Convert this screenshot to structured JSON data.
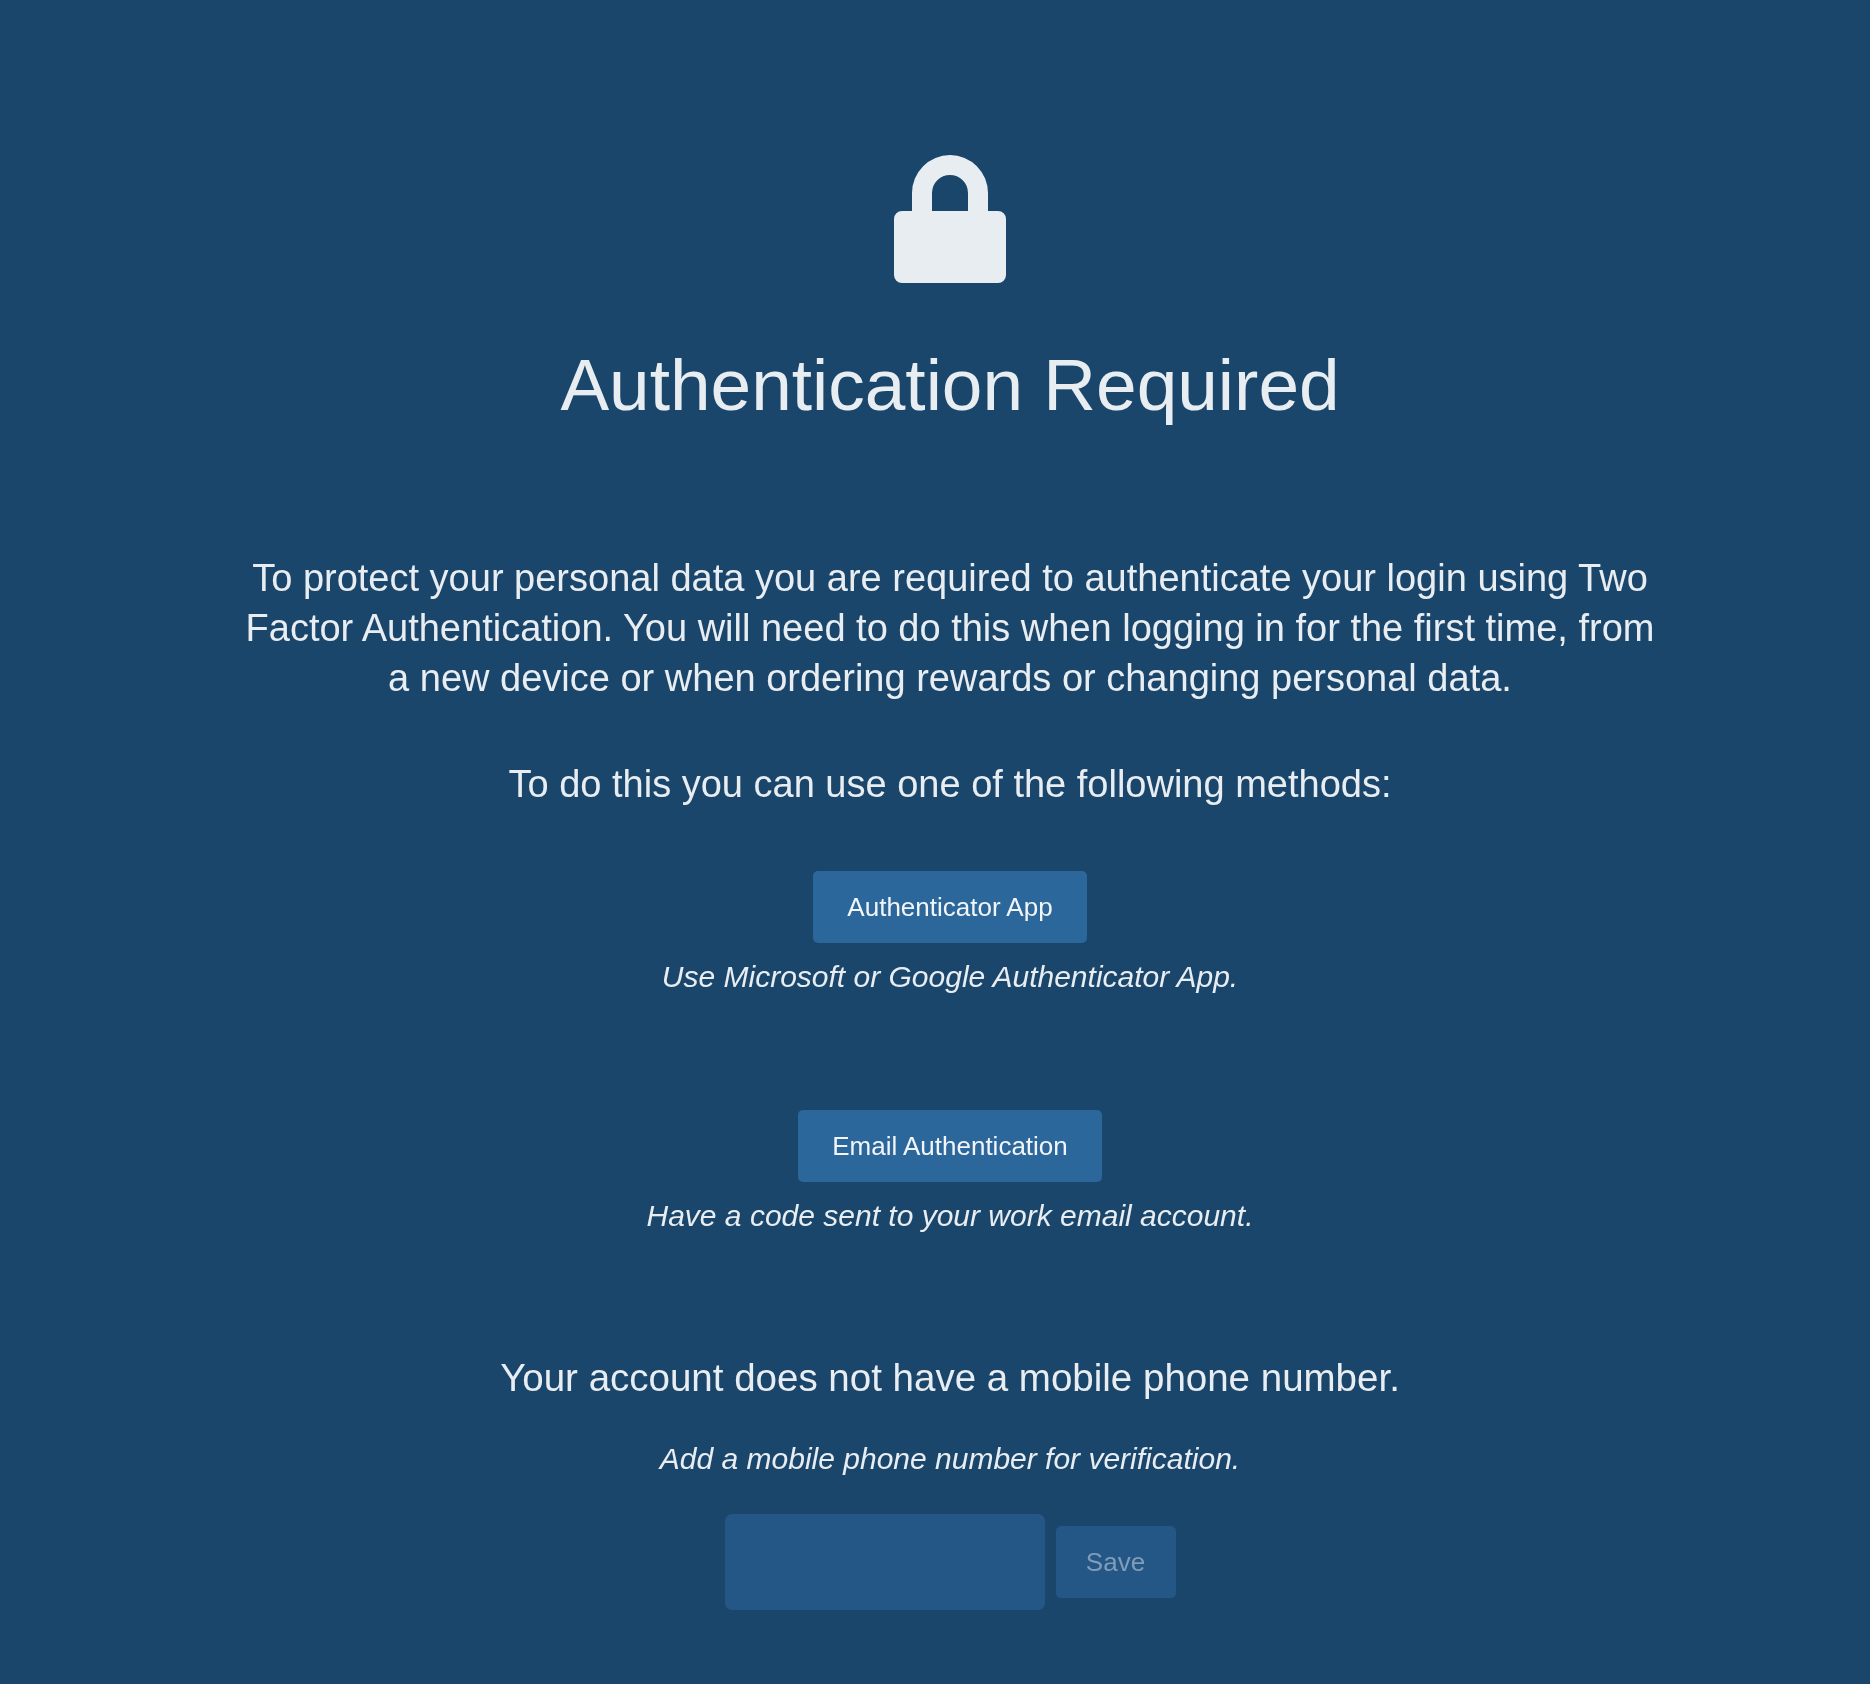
{
  "title": "Authentication Required",
  "intro": "To protect your personal data you are required to authenticate your login using Two Factor Authentication. You will need to do this when logging in for the first time, from a new device or when ordering rewards or changing personal data.",
  "methods_prompt": "To do this you can use one of the following methods:",
  "methods": [
    {
      "label": "Authenticator App",
      "description": "Use Microsoft or Google Authenticator App."
    },
    {
      "label": "Email Authentication",
      "description": "Have a code sent to your work email account."
    }
  ],
  "mobile": {
    "notice": "Your account does not have a mobile phone number.",
    "hint": "Add a mobile phone number for verification.",
    "save_button": {
      "label": "Save",
      "disabled": true
    }
  }
}
